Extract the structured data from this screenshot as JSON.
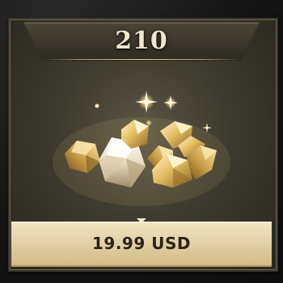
{
  "offer": {
    "amount": "210",
    "price": "19.99 USD",
    "item_icon": "gem-pile-icon"
  },
  "colors": {
    "card_bg": "#3d3a2f",
    "price_bar": "#e2d1a5",
    "amount_text": "#efe6cf",
    "price_text": "#2b2418",
    "gem_gold": "#e8c46a"
  }
}
